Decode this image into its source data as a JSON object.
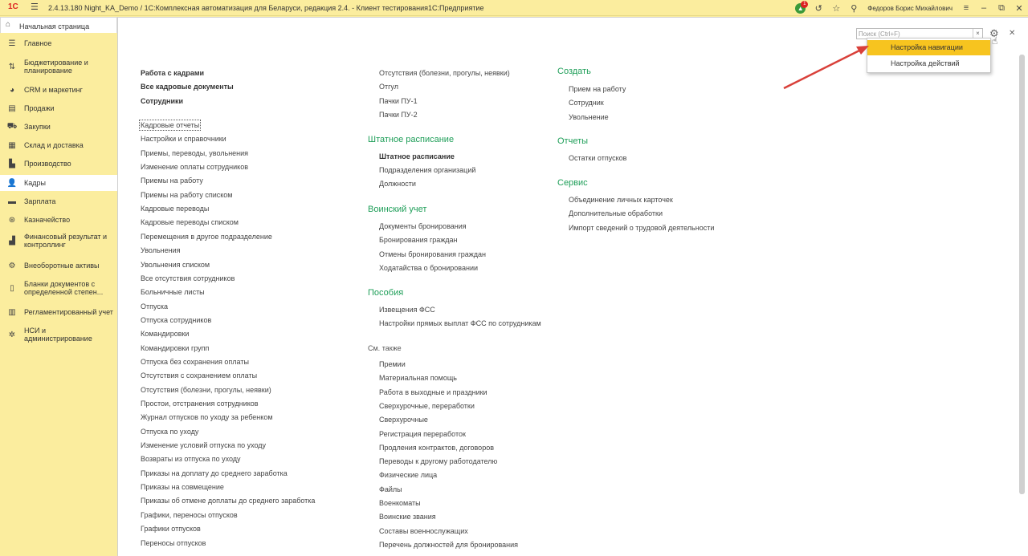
{
  "titlebar": {
    "logo": "1С",
    "title": "2.4.13.180 Night_KA_Demo / 1С:Комплексная автоматизация для Беларуси, редакция 2.4.   - Клиент тестирования1С:Предприятие",
    "notification_count": "1",
    "user": "Федоров Борис Михайлович"
  },
  "home_tab": {
    "label": "Начальная страница"
  },
  "sidebar": {
    "items": [
      {
        "label": "Главное",
        "icon": "☰"
      },
      {
        "label": "Бюджетирование и планирование",
        "icon": "⇅"
      },
      {
        "label": "CRM и маркетинг",
        "icon": "◕"
      },
      {
        "label": "Продажи",
        "icon": "▤"
      },
      {
        "label": "Закупки",
        "icon": "⛟"
      },
      {
        "label": "Склад и доставка",
        "icon": "▦"
      },
      {
        "label": "Производство",
        "icon": "▙"
      },
      {
        "label": "Кадры",
        "icon": "👤"
      },
      {
        "label": "Зарплата",
        "icon": "▬"
      },
      {
        "label": "Казначейство",
        "icon": "⊛"
      },
      {
        "label": "Финансовый результат и контроллинг",
        "icon": "▟"
      },
      {
        "label": "Внеоборотные активы",
        "icon": "⚙"
      },
      {
        "label": "Бланки документов с определенной степен...",
        "icon": "▯"
      },
      {
        "label": "Регламентированный учет",
        "icon": "▥"
      },
      {
        "label": "НСИ и администрирование",
        "icon": "✲"
      }
    ]
  },
  "search": {
    "placeholder": "Поиск (Ctrl+F)",
    "clear": "×"
  },
  "popup": {
    "items": [
      "Настройка навигации",
      "Настройка действий"
    ]
  },
  "col1": {
    "bold": [
      "Работа с кадрами",
      "Все кадровые документы",
      "Сотрудники"
    ],
    "links": [
      "Кадровые отчеты",
      "Настройки и справочники",
      "Приемы, переводы, увольнения",
      "Изменение оплаты сотрудников",
      "Приемы на работу",
      "Приемы на работу списком",
      "Кадровые переводы",
      "Кадровые переводы списком",
      "Перемещения в другое подразделение",
      "Увольнения",
      "Увольнения списком",
      "Все отсутствия сотрудников",
      "Больничные листы",
      "Отпуска",
      "Отпуска сотрудников",
      "Командировки",
      "Командировки групп",
      "Отпуска без сохранения оплаты",
      "Отсутствия с сохранением оплаты",
      "Отсутствия (болезни, прогулы, неявки)",
      "Простои, отстранения сотрудников",
      "Журнал отпусков по уходу за ребенком",
      "Отпуска по уходу",
      "Изменение условий отпуска по уходу",
      "Возвраты из отпуска по уходу",
      "Приказы на доплату до среднего заработка",
      "Приказы на совмещение",
      "Приказы об отмене доплаты до среднего заработка",
      "Графики, переносы отпусков",
      "Графики отпусков",
      "Переносы отпусков"
    ]
  },
  "col2": {
    "top_links": [
      "Отсутствия (болезни, прогулы, неявки)",
      "Отгул",
      "Пачки ПУ-1",
      "Пачки ПУ-2"
    ],
    "staff": {
      "title": "Штатное расписание",
      "bold": "Штатное расписание",
      "links": [
        "Подразделения организаций",
        "Должности"
      ]
    },
    "military": {
      "title": "Воинский учет",
      "links": [
        "Документы бронирования",
        "Бронирования граждан",
        "Отмены бронирования граждан",
        "Ходатайства о бронировании"
      ]
    },
    "benefits": {
      "title": "Пособия",
      "links": [
        "Извещения ФСС",
        "Настройки прямых выплат ФСС по сотрудникам"
      ]
    },
    "see_also": {
      "title": "См. также",
      "links": [
        "Премии",
        "Материальная помощь",
        "Работа в выходные и праздники",
        "Сверхурочные, переработки",
        "Сверхурочные",
        "Регистрация переработок",
        "Продления контрактов, договоров",
        "Переводы к другому работодателю",
        "Физические лица",
        "Файлы",
        "Военкоматы",
        "Воинские звания",
        "Составы военнослужащих",
        "Перечень должностей для бронирования"
      ]
    }
  },
  "col3": {
    "create": {
      "title": "Создать",
      "links": [
        "Прием на работу",
        "Сотрудник",
        "Увольнение"
      ]
    },
    "reports": {
      "title": "Отчеты",
      "links": [
        "Остатки отпусков"
      ]
    },
    "service": {
      "title": "Сервис",
      "links": [
        "Объединение личных карточек",
        "Дополнительные обработки",
        "Импорт сведений о трудовой деятельности"
      ]
    }
  },
  "colors": {
    "accent": "#f7c41f",
    "section": "#1e9e58",
    "sidebar_bg": "#fbed9e",
    "arrow": "#d9403a"
  }
}
